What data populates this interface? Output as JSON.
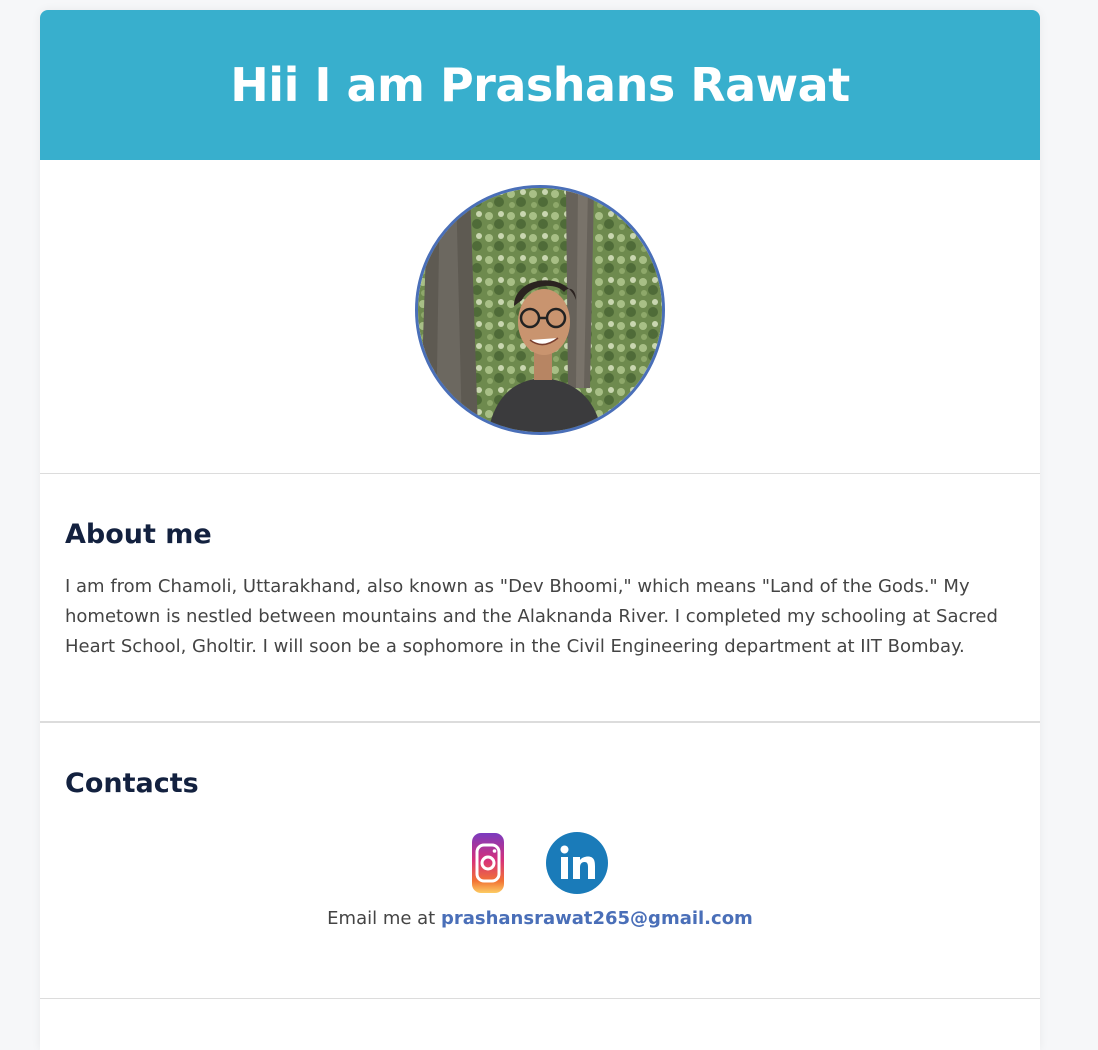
{
  "header": {
    "title": "Hii I am Prashans Rawat"
  },
  "profile": {
    "photo_icon": "profile-photo"
  },
  "about": {
    "heading": "About me",
    "text": "I am from Chamoli, Uttarakhand, also known as \"Dev Bhoomi,\" which means \"Land of the Gods.\" My hometown is nestled between mountains and the Alaknanda River. I completed my schooling at Sacred Heart School, Gholtir. I will soon be a sophomore in the Civil Engineering department at IIT Bombay."
  },
  "contacts": {
    "heading": "Contacts",
    "icons": [
      "instagram-icon",
      "linkedin-icon"
    ],
    "email_prefix": "Email me at ",
    "email": "prashansrawat265@gmail.com"
  },
  "colors": {
    "header_bg": "#38afcd",
    "accent": "#4a6fb8",
    "heading": "#13213f"
  }
}
